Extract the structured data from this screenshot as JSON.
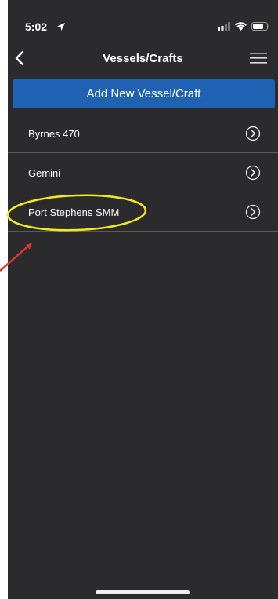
{
  "status_bar": {
    "time": "5:02",
    "location_icon": "location-arrow-icon",
    "signal_icon": "signal-icon",
    "wifi_icon": "wifi-icon",
    "battery_icon": "battery-icon"
  },
  "navbar": {
    "title": "Vessels/Crafts",
    "back_icon": "chevron-left-icon",
    "menu_icon": "hamburger-menu-icon"
  },
  "add_button": {
    "label": "Add New Vessel/Craft",
    "color": "#1f62b3"
  },
  "vessels": [
    {
      "label": "Byrnes 470",
      "icon": "chevron-circle-right-icon"
    },
    {
      "label": "Gemini",
      "icon": "chevron-circle-right-icon"
    },
    {
      "label": "Port Stephens SMM",
      "icon": "chevron-circle-right-icon"
    }
  ],
  "annotation": {
    "highlight_color": "#f2ea1a",
    "arrow_color": "#e0342b"
  },
  "colors": {
    "background": "#2b2b2e",
    "separator": "#5a5a5e",
    "text": "#ffffff"
  }
}
